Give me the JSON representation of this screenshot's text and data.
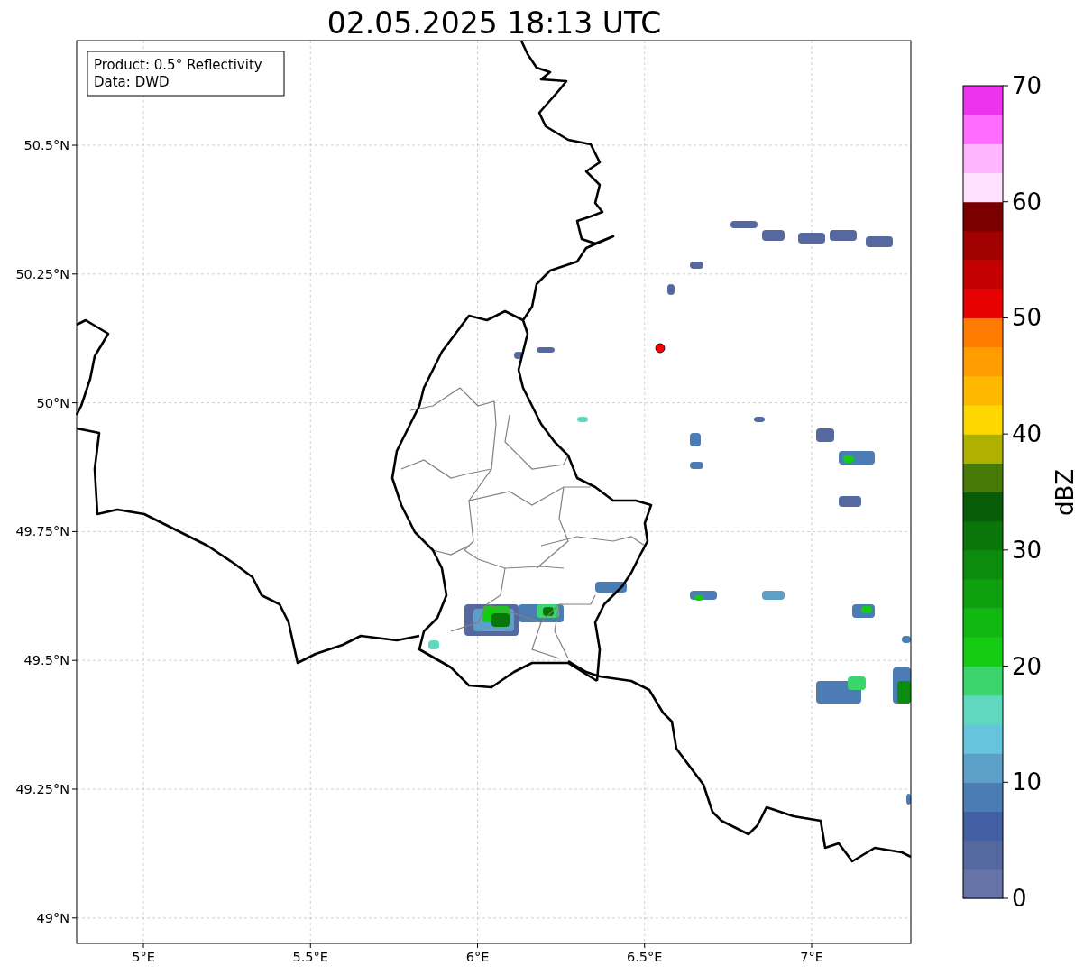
{
  "title": "02.05.2025 18:13 UTC",
  "info_box": {
    "lines": [
      "Product: 0.5° Reflectivity",
      "Data: DWD"
    ]
  },
  "x_ticks": [
    "5°E",
    "5.5°E",
    "6°E",
    "6.5°E",
    "7°E"
  ],
  "y_ticks": [
    "50.5°N",
    "50.25°N",
    "50°N",
    "49.75°N",
    "49.5°N",
    "49.25°N",
    "49°N"
  ],
  "colorbar": {
    "label": "dBZ",
    "ticks": [
      "70",
      "60",
      "50",
      "40",
      "30",
      "20",
      "10",
      "0"
    ],
    "segments": [
      {
        "color": "#6674a8"
      },
      {
        "color": "#5568a0"
      },
      {
        "color": "#4460a4"
      },
      {
        "color": "#4c7cb4"
      },
      {
        "color": "#5ca0c8"
      },
      {
        "color": "#66c4dc"
      },
      {
        "color": "#60d8c0"
      },
      {
        "color": "#3cd46c"
      },
      {
        "color": "#14cc14"
      },
      {
        "color": "#10b810"
      },
      {
        "color": "#0ea00e"
      },
      {
        "color": "#0c8c0c"
      },
      {
        "color": "#0a760a"
      },
      {
        "color": "#085c08"
      },
      {
        "color": "#487a08"
      },
      {
        "color": "#b0b000"
      },
      {
        "color": "#ffd700"
      },
      {
        "color": "#ffb800"
      },
      {
        "color": "#ff9c00"
      },
      {
        "color": "#ff7c00"
      },
      {
        "color": "#e60000"
      },
      {
        "color": "#c40000"
      },
      {
        "color": "#a00000"
      },
      {
        "color": "#7a0000"
      },
      {
        "color": "#ffe0ff"
      },
      {
        "color": "#ffb4ff"
      },
      {
        "color": "#ff6cff"
      },
      {
        "color": "#ee33ee"
      }
    ]
  }
}
